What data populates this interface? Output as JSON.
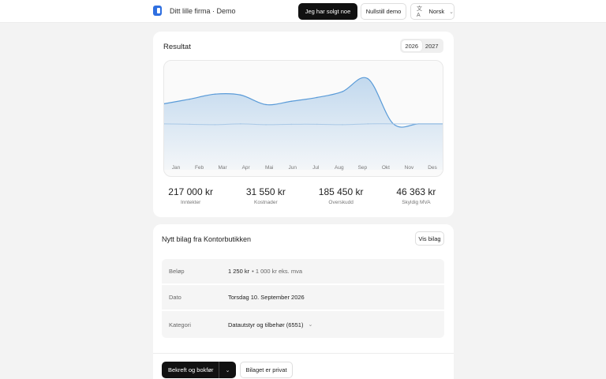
{
  "header": {
    "brand": "Ditt lille firma · Demo",
    "sold_button": "Jeg har solgt noe",
    "reset_button": "Nullstill demo",
    "language": "Norsk",
    "language_icon": "translate-icon"
  },
  "result": {
    "title": "Resultat",
    "years": [
      "2026",
      "2027"
    ],
    "active_year": "2026",
    "stats": [
      {
        "value": "217 000 kr",
        "label": "Inntekter"
      },
      {
        "value": "31 550 kr",
        "label": "Kostnader"
      },
      {
        "value": "185 450 kr",
        "label": "Overskudd"
      },
      {
        "value": "46 363 kr",
        "label": "Skyldig MVA"
      }
    ]
  },
  "chart_data": {
    "type": "area",
    "categories": [
      "Jan",
      "Feb",
      "Mar",
      "Apr",
      "Mai",
      "Jun",
      "Jul",
      "Aug",
      "Sep",
      "Okt",
      "Nov",
      "Des"
    ],
    "series": [
      {
        "values": [
          120,
          131,
          143,
          141,
          118,
          126,
          135,
          149,
          180,
          72,
          72,
          72
        ],
        "color": "#5a9bd8"
      },
      {
        "values": [
          72,
          71,
          70,
          72,
          70,
          71,
          71,
          70,
          72,
          72,
          72,
          72
        ],
        "color": "#a9c8e6"
      }
    ],
    "accent": "#5a9bd8"
  },
  "bilag": {
    "title": "Nytt bilag fra  Kontorbutikken",
    "view_button": "Vis bilag",
    "rows": [
      {
        "label": "Beløp",
        "value": "1 250 kr",
        "extra": "• 1 000 kr eks. mva"
      },
      {
        "label": "Dato",
        "value": "Torsdag 10. September 2026"
      },
      {
        "label": "Kategori",
        "value": "Datautstyr og tilbehør (6551)"
      }
    ],
    "confirm_button": "Bekreft og bokfør",
    "private_button": "Bilaget er privat"
  }
}
